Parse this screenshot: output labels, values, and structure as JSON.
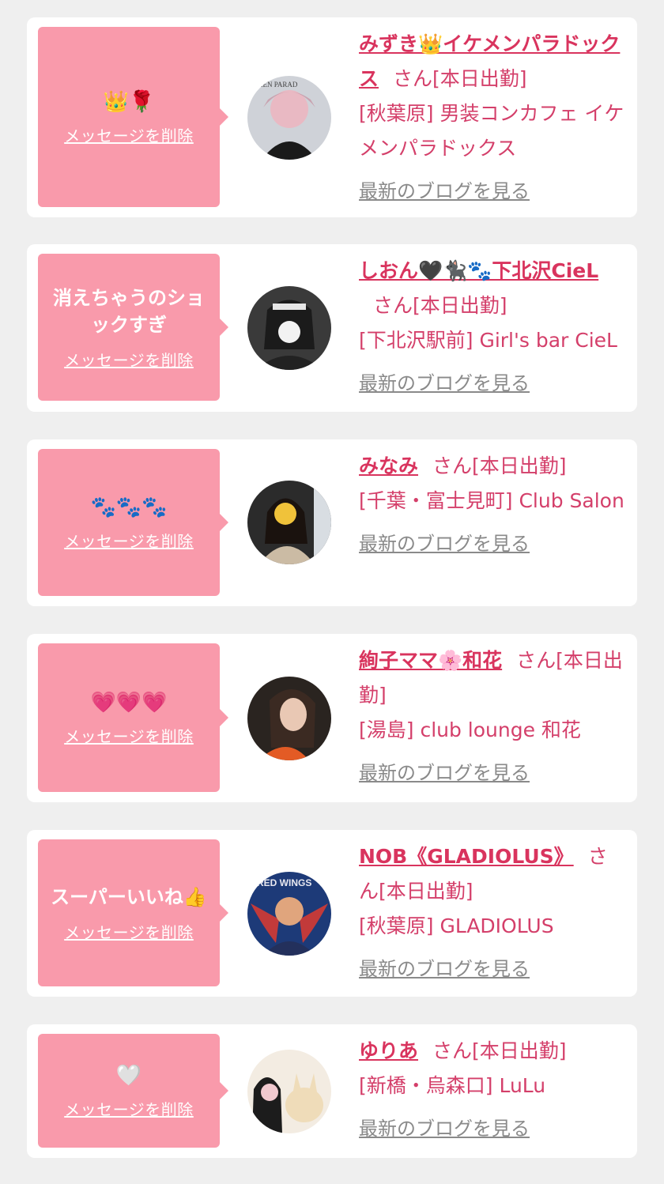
{
  "delete_label": "メッセージを削除",
  "blog_label": "最新のブログを見る",
  "cards": [
    {
      "message_text": "",
      "message_emoji": "👑🌹",
      "name": "みずき👑イケメンパラドックス",
      "suffix": "さん[本日出勤]",
      "shop": "[秋葉原] 男装コンカフェ イケメンパラドックス",
      "avatar_icon": "avatar-photo"
    },
    {
      "message_text": "消えちゃうのショックすぎ",
      "message_emoji": "",
      "name": "しおん🖤🐈‍⬛🐾下北沢CieL",
      "suffix": "さん[本日出勤]",
      "shop": "[下北沢駅前] Girl's bar CieL",
      "avatar_icon": "avatar-photo"
    },
    {
      "message_text": "",
      "message_emoji": "🐾🐾🐾",
      "name": "みなみ",
      "suffix": "さん[本日出勤]",
      "shop": "[千葉・富士見町] Club Salon",
      "avatar_icon": "avatar-photo"
    },
    {
      "message_text": "",
      "message_emoji": "💗💗💗",
      "name": "絢子ママ🌸和花",
      "suffix": "さん[本日出勤]",
      "shop": "[湯島] club lounge 和花",
      "avatar_icon": "avatar-photo"
    },
    {
      "message_text": "スーパーいいね👍",
      "message_emoji": "",
      "name": "NOB《GLADIOLUS》",
      "suffix": "さん[本日出勤]",
      "shop": "[秋葉原] GLADIOLUS",
      "avatar_icon": "avatar-photo"
    },
    {
      "message_text": "",
      "message_emoji": "🤍",
      "name": "ゆりあ",
      "suffix": "さん[本日出勤]",
      "shop": "[新橋・烏森口] LuLu",
      "avatar_icon": "avatar-photo"
    }
  ]
}
